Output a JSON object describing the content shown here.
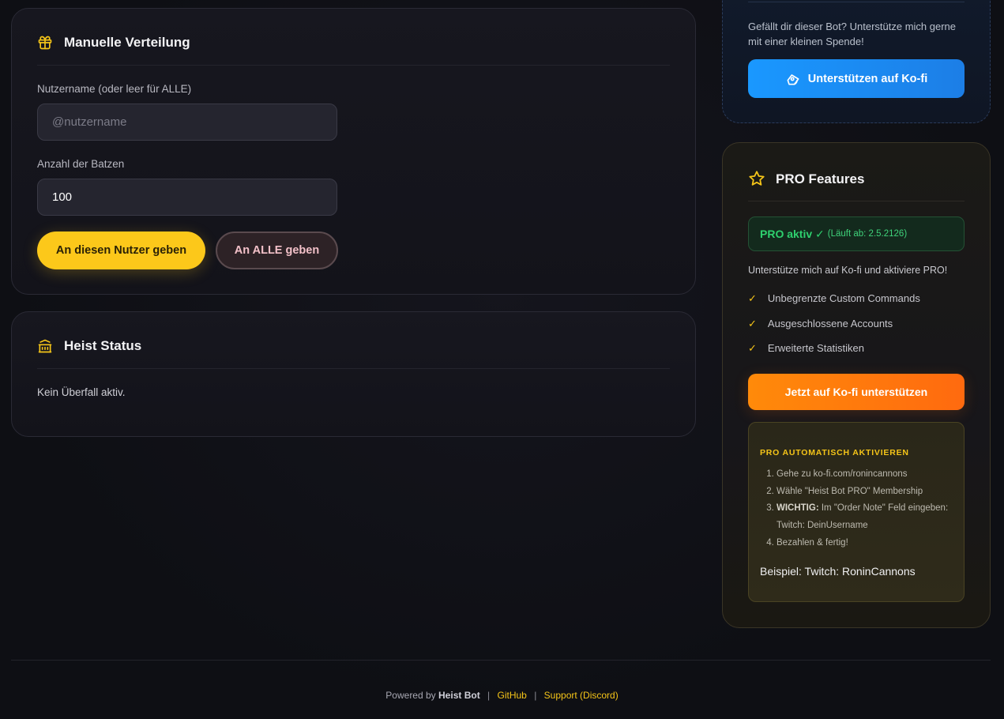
{
  "manual": {
    "title": "Manuelle Verteilung",
    "icon": "gift-icon",
    "username_label": "Nutzername (oder leer für ALLE)",
    "username_placeholder": "@nutzername",
    "username_value": "",
    "amount_label": "Anzahl der Batzen",
    "amount_value": "100",
    "give_user_button": "An diesen Nutzer geben",
    "give_all_button": "An ALLE geben"
  },
  "heist": {
    "title": "Heist Status",
    "icon": "bank-icon",
    "status_text": "Kein Überfall aktiv."
  },
  "donate": {
    "text": "Gefällt dir dieser Bot? Unterstütze mich gerne mit einer kleinen Spende!",
    "button": "Unterstützen auf Ko-fi",
    "button_icon": "kofi-cup-icon"
  },
  "pro": {
    "title": "PRO Features",
    "icon": "star-icon",
    "active_label": "PRO aktiv ✓",
    "active_expiry": "(Läuft ab: 2.5.2126)",
    "support_text": "Unterstütze mich auf Ko-fi und aktiviere PRO!",
    "features": [
      "Unbegrenzte Custom Commands",
      "Ausgeschlossene Accounts",
      "Erweiterte Statistiken"
    ],
    "check_mark": "✓",
    "cta_button": "Jetzt auf Ko-fi unterstützen",
    "auto": {
      "title": "PRO AUTOMATISCH AKTIVIEREN",
      "steps": {
        "s1": "Gehe zu ko-fi.com/ronincannons",
        "s2": "Wähle \"Heist Bot PRO\" Membership",
        "s3_bold": "WICHTIG:",
        "s3_text": " Im \"Order Note\" Feld eingeben: Twitch: DeinUsername",
        "s4": "Bezahlen & fertig!"
      },
      "example": "Beispiel: Twitch: RoninCannons"
    }
  },
  "footer": {
    "powered_by": "Powered by",
    "brand": "Heist Bot",
    "sep": "|",
    "github": "GitHub",
    "support": "Support (Discord)"
  },
  "colors": {
    "gold": "#fcc81a",
    "blue": "#1a8fff",
    "orange": "#ff7a0a",
    "green": "#2ed06e"
  }
}
